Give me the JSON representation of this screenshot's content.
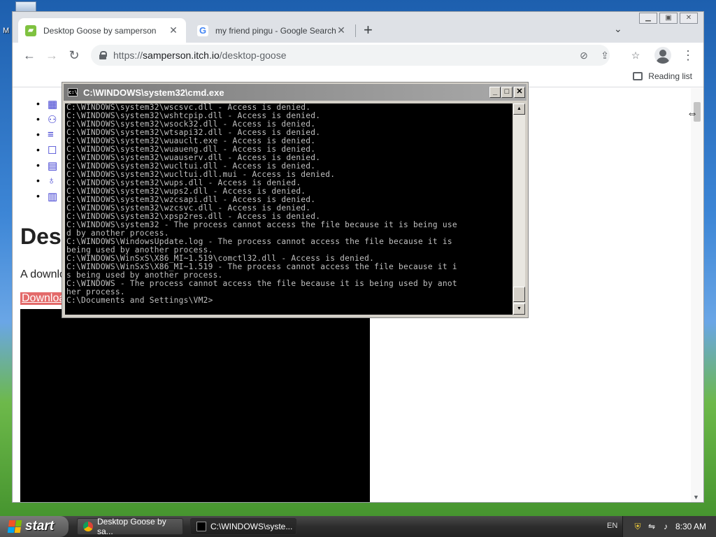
{
  "desktop": {
    "icon_label": "M"
  },
  "browser": {
    "tabs": [
      {
        "title": "Desktop Goose by samperson",
        "icon": "itch-icon",
        "active": true
      },
      {
        "title": "my friend pingu - Google Search",
        "icon": "google-icon",
        "active": false
      }
    ],
    "url": {
      "prefix": "https://",
      "host": "samperson.itch.io",
      "path": "/desktop-goose"
    },
    "reading_list": "Reading list",
    "page": {
      "heading": "Des",
      "lede": "A downlo",
      "download_link": "Downloa",
      "nav_icons": [
        "store-icon",
        "add-user-icon",
        "add-to-list-icon",
        "chat-icon",
        "article-icon",
        "award-icon",
        "map-icon"
      ]
    }
  },
  "cmd": {
    "title": "C:\\WINDOWS\\system32\\cmd.exe",
    "lines": [
      "C:\\WINDOWS\\system32\\wscsvc.dll - Access is denied.",
      "C:\\WINDOWS\\system32\\wshtcpip.dll - Access is denied.",
      "C:\\WINDOWS\\system32\\wsock32.dll - Access is denied.",
      "C:\\WINDOWS\\system32\\wtsapi32.dll - Access is denied.",
      "C:\\WINDOWS\\system32\\wuauclt.exe - Access is denied.",
      "C:\\WINDOWS\\system32\\wuaueng.dll - Access is denied.",
      "C:\\WINDOWS\\system32\\wuauserv.dll - Access is denied.",
      "C:\\WINDOWS\\system32\\wucltui.dll - Access is denied.",
      "C:\\WINDOWS\\system32\\wucltui.dll.mui - Access is denied.",
      "C:\\WINDOWS\\system32\\wups.dll - Access is denied.",
      "C:\\WINDOWS\\system32\\wups2.dll - Access is denied.",
      "C:\\WINDOWS\\system32\\wzcsapi.dll - Access is denied.",
      "C:\\WINDOWS\\system32\\wzcsvc.dll - Access is denied.",
      "C:\\WINDOWS\\system32\\xpsp2res.dll - Access is denied.",
      "C:\\WINDOWS\\system32 - The process cannot access the file because it is being use",
      "d by another process.",
      "C:\\WINDOWS\\WindowsUpdate.log - The process cannot access the file because it is",
      "being used by another process.",
      "C:\\WINDOWS\\WinSxS\\X86_MI~1.519\\comctl32.dll - Access is denied.",
      "C:\\WINDOWS\\WinSxS\\X86_MI~1.519 - The process cannot access the file because it i",
      "s being used by another process.",
      "C:\\WINDOWS - The process cannot access the file because it is being used by anot",
      "her process.",
      "",
      "C:\\Documents and Settings\\VM2>"
    ]
  },
  "taskbar": {
    "start_label": "start",
    "tasks": [
      {
        "label": "Desktop Goose by sa...",
        "icon": "chrome-icon"
      },
      {
        "label": "C:\\WINDOWS\\syste...",
        "icon": "cmd-icon"
      }
    ],
    "lang": "EN",
    "clock": "8:30 AM"
  }
}
